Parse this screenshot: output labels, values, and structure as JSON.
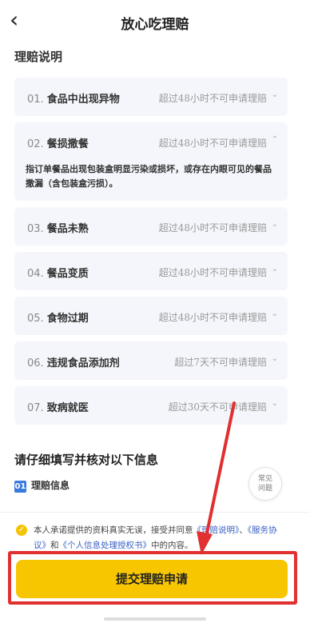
{
  "header": {
    "back_icon": "‹",
    "title": "放心吃理赔"
  },
  "section": {
    "title": "理赔说明"
  },
  "items": [
    {
      "num": "01.",
      "name": "食品中出现异物",
      "limit": "超过48小时不可申请理赔",
      "chevron": "⌄"
    },
    {
      "num": "02.",
      "name": "餐损撒餐",
      "limit": "超过48小时不可申请理赔",
      "chevron": "⌃",
      "desc": "指订单餐品出现包装盒明显污染或损坏，或存在内眼可见的餐品撒漏（含包装盒污损）。"
    },
    {
      "num": "03.",
      "name": "餐品未熟",
      "limit": "超过48小时不可申请理赔",
      "chevron": "⌄"
    },
    {
      "num": "04.",
      "name": "餐品变质",
      "limit": "超过48小时不可申请理赔",
      "chevron": "⌄"
    },
    {
      "num": "05.",
      "name": "食物过期",
      "limit": "超过48小时不可申请理赔",
      "chevron": "⌄"
    },
    {
      "num": "06.",
      "name": "违规食品添加剂",
      "limit": "超过7天不可申请理赔",
      "chevron": "⌄"
    },
    {
      "num": "07.",
      "name": "致病就医",
      "limit": "超过30天不可申请理赔",
      "chevron": "⌄"
    }
  ],
  "fill": {
    "title": "请仔细填写并核对以下信息",
    "tag": "01",
    "info_label": "理赔信息"
  },
  "faq": {
    "line1": "常见",
    "line2": "问题"
  },
  "consent": {
    "check": "✓",
    "prefix": "本人承诺提供的资料真实无误，接受并同意",
    "link1": "《理赔说明》",
    "sep1": "、",
    "link2": "《服务协议》",
    "and": "和",
    "link3": "《个人信息处理授权书》",
    "suffix": "中的内容。"
  },
  "submit": {
    "label": "提交理赔申请"
  },
  "colors": {
    "accent": "#f7c600",
    "annotation": "#e03030",
    "link": "#3a5fc4"
  }
}
